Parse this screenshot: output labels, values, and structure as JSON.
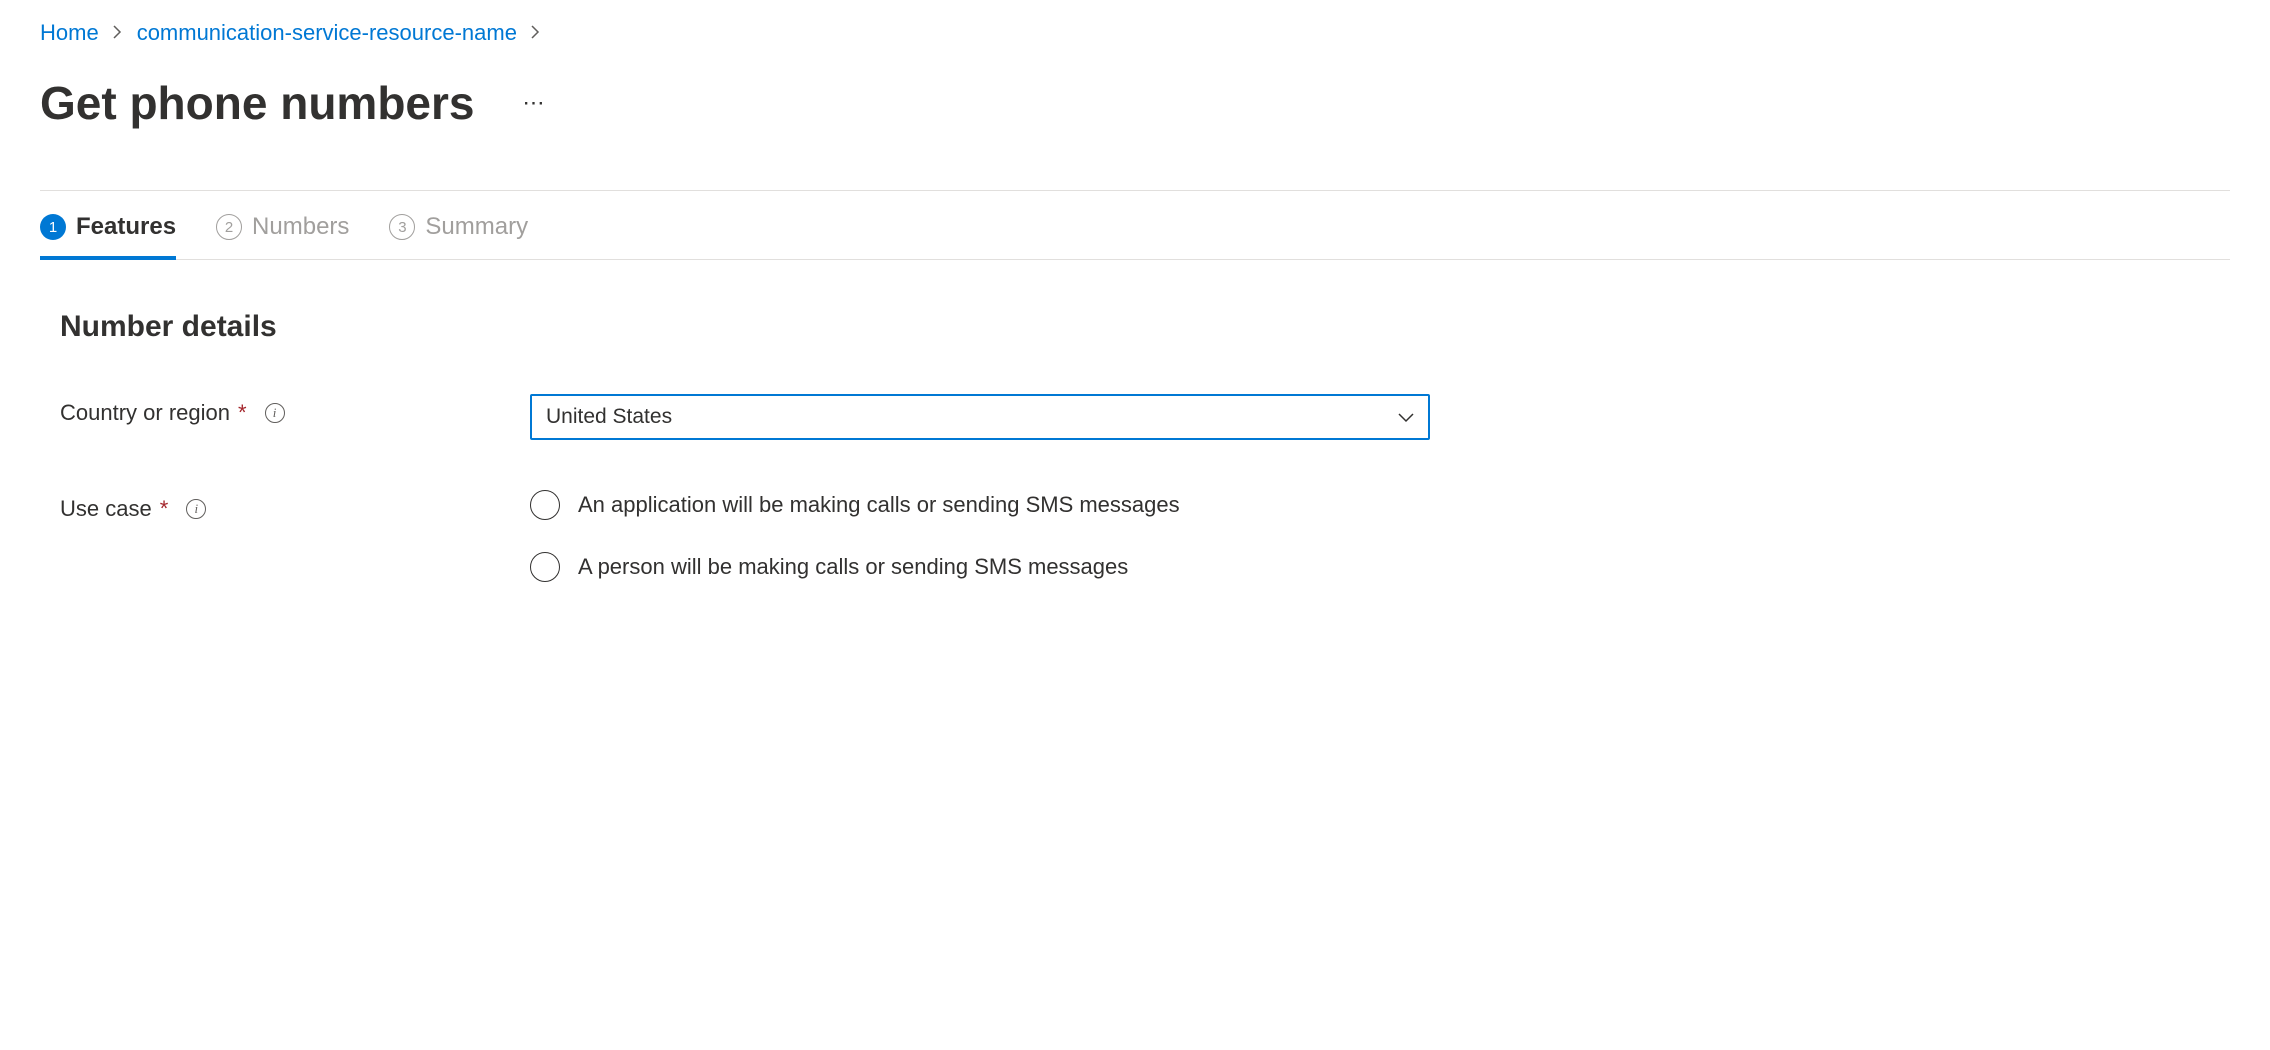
{
  "breadcrumb": {
    "home": "Home",
    "resource": "communication-service-resource-name"
  },
  "page": {
    "title": "Get phone numbers",
    "more": "⋯"
  },
  "tabs": {
    "features": {
      "num": "1",
      "label": "Features"
    },
    "numbers": {
      "num": "2",
      "label": "Numbers"
    },
    "summary": {
      "num": "3",
      "label": "Summary"
    }
  },
  "section": {
    "title": "Number details"
  },
  "form": {
    "country": {
      "label": "Country or region",
      "value": "United States"
    },
    "usecase": {
      "label": "Use case",
      "options": {
        "app": "An application will be making calls or sending SMS messages",
        "person": "A person will be making calls or sending SMS messages"
      }
    }
  }
}
